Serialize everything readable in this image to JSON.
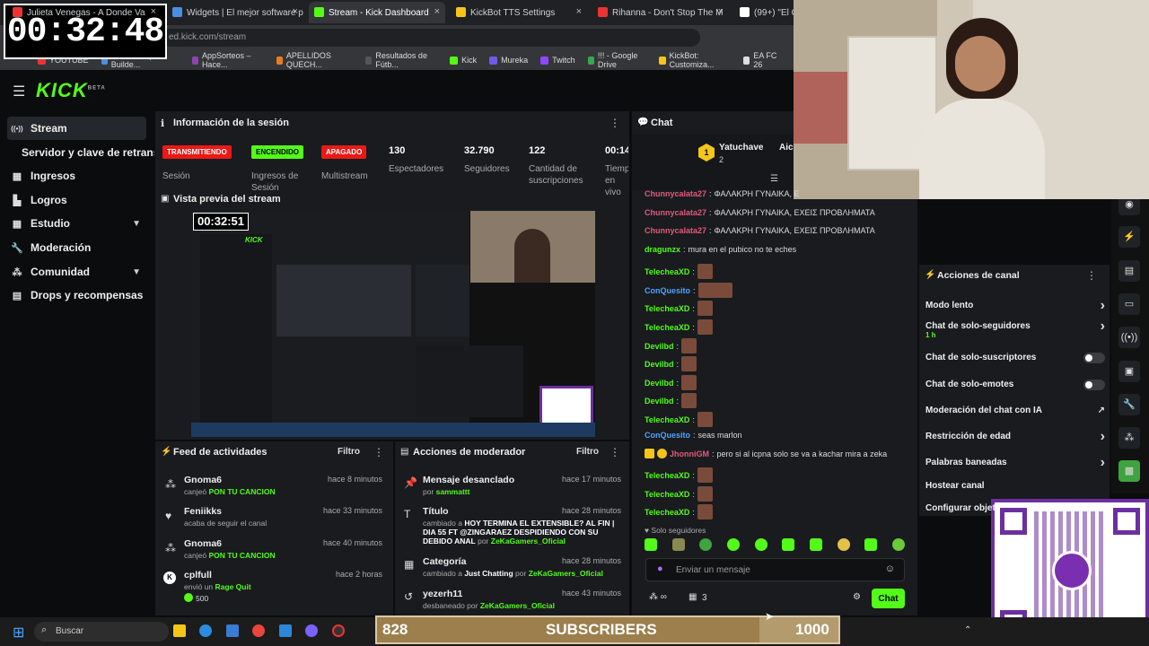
{
  "overlay": {
    "timer": "00:32:48",
    "sub_goal": {
      "current": "828",
      "label": "SUBSCRIBERS",
      "target": "1000",
      "progress": 0.828
    }
  },
  "browser": {
    "tabs": [
      {
        "label": "Julieta Venegas - A Donde Va",
        "color": "#e33"
      },
      {
        "label": "Widgets | El mejor software par",
        "color": "#4a90e2"
      },
      {
        "label": "Stream - Kick Dashboard",
        "color": "#53fc18"
      },
      {
        "label": "KickBot TTS Settings",
        "color": "#f5c518"
      },
      {
        "label": "Rihanna - Don't Stop The M",
        "color": "#e33"
      },
      {
        "label": "(99+) \"El Ori",
        "color": "#fff"
      }
    ],
    "url_prefix": "ed.kick.com/",
    "url_path": "stream",
    "bookmarks": [
      {
        "label": "YOUTUBE",
        "color": "#e33"
      },
      {
        "label": "FIFA 19 Squad Builde...",
        "color": "#4a90e2"
      },
      {
        "label": "AppSorteos – Hace...",
        "color": "#8e44ad"
      },
      {
        "label": "APELLIDOS QUECH...",
        "color": "#e67e22"
      },
      {
        "label": "Resultados de Fútb...",
        "color": "#555"
      },
      {
        "label": "Kick",
        "color": "#53fc18"
      },
      {
        "label": "Mureka",
        "color": "#6c5ce7"
      },
      {
        "label": "Twitch",
        "color": "#9146ff"
      },
      {
        "label": "!!! - Google Drive",
        "color": "#34a853"
      },
      {
        "label": "KickBot: Customiza...",
        "color": "#f5c518"
      },
      {
        "label": "EA FC 26",
        "color": "#ddd"
      }
    ]
  },
  "brand": {
    "logo": "KICK",
    "beta": "BETA",
    "accent": "#53fc18"
  },
  "sidebar": {
    "items": [
      {
        "label": "Stream",
        "icon": "broadcast-icon"
      },
      {
        "label": "Servidor y clave de retransm"
      },
      {
        "label": "Ingresos",
        "icon": "coins-icon"
      },
      {
        "label": "Logros",
        "icon": "trophy-icon"
      },
      {
        "label": "Estudio",
        "icon": "grid-icon"
      },
      {
        "label": "Moderación",
        "icon": "wrench-icon"
      },
      {
        "label": "Comunidad",
        "icon": "people-icon"
      },
      {
        "label": "Drops y recompensas",
        "icon": "gift-icon"
      }
    ]
  },
  "session": {
    "title": "Información de la sesión",
    "stats": [
      {
        "value": "TRANSMITIENDO",
        "label": "Sesión",
        "badge_color": "#e91916"
      },
      {
        "value": "ENCENDIDO",
        "label": "Ingresos de Sesión",
        "badge_color": "#53fc18"
      },
      {
        "value": "APAGADO",
        "label": "Multistream",
        "badge_color": "#e91916"
      },
      {
        "value": "130",
        "label": "Espectadores"
      },
      {
        "value": "32.790",
        "label": "Seguidores"
      },
      {
        "value": "122",
        "label": "Cantidad de suscripciones"
      },
      {
        "value": "00:14:",
        "label": "Tiempo en vivo"
      }
    ]
  },
  "preview": {
    "title": "Vista previa del stream",
    "timer": "00:32:51"
  },
  "activity": {
    "title": "Feed de actividades",
    "filter": "Filtro",
    "items": [
      {
        "name": "Gnoma6",
        "time": "hace 8 minutos",
        "action": "canjeó",
        "highlight": "PON TU CANCION",
        "icon": "reward-icon"
      },
      {
        "name": "Feniikks",
        "time": "hace 33 minutos",
        "action": "acaba de seguir el canal",
        "highlight": "",
        "icon": "heart-icon"
      },
      {
        "name": "Gnoma6",
        "time": "hace 40 minutos",
        "action": "canjeó",
        "highlight": "PON TU CANCION",
        "icon": "reward-icon"
      },
      {
        "name": "cplfull",
        "time": "hace 2 horas",
        "action": "envió un",
        "highlight": "Rage Quit",
        "extra": "500",
        "icon": "kick-coin-icon"
      }
    ]
  },
  "modactions": {
    "title": "Acciones de moderador",
    "filter": "Filtro",
    "items": [
      {
        "title": "Mensaje desanclado",
        "time": "hace 17 minutos",
        "pre": "por",
        "user": "sammattt"
      },
      {
        "title": "Título",
        "time": "hace 28 minutos",
        "pre": "cambiado a",
        "value": "HOY TERMINA EL EXTENSIBLE? AL FIN | DIA 55 FT @ZINGARAEZ DESPIDIENDO CON SU DEBIDO ANAL",
        "mid": "por",
        "user": "ZeKaGamers_Oficial"
      },
      {
        "title": "Categoría",
        "time": "hace 28 minutos",
        "pre": "cambiado a",
        "value": "Just Chatting",
        "mid": "por",
        "user": "ZeKaGamers_Oficial"
      },
      {
        "title": "yezerh11",
        "time": "hace 43 minutos",
        "pre": "desbaneado por",
        "user": "ZeKaGamers_Oficial"
      }
    ]
  },
  "chat": {
    "title": "Chat",
    "pinned_user": "Yatuchave",
    "pinned_count": "2",
    "pinned_extra": "Aic",
    "messages": [
      {
        "user": "Chunnycalata27",
        "color": "#e05a7a",
        "text": "ΦΑΛΑΚΡΗ ΓΥΝΑΙΚΑ, Ε"
      },
      {
        "user": "Chunnycalata27",
        "color": "#e05a7a",
        "text": "ΦΑΛΑΚΡΗ ΓΥΝΑΙΚΑ, ΕΧΕΙΣ ΠΡΟΒΛΗΜΑΤΑ"
      },
      {
        "user": "Chunnycalata27",
        "color": "#e05a7a",
        "text": "ΦΑΛΑΚΡΗ ΓΥΝΑΙΚΑ, ΕΧΕΙΣ ΠΡΟΒΛΗΜΑΤΑ"
      },
      {
        "user": "dragunzx",
        "color": "#53fc18",
        "text": "mura en el pubico no te eches"
      },
      {
        "user": "TelecheaXD",
        "color": "#53fc18",
        "text": "",
        "emote": 1
      },
      {
        "user": "ConQuesito",
        "color": "#4ea3ff",
        "text": "",
        "emote": 2
      },
      {
        "user": "TelecheaXD",
        "color": "#53fc18",
        "text": "",
        "emote": 1
      },
      {
        "user": "TelecheaXD",
        "color": "#53fc18",
        "text": "",
        "emote": 1
      },
      {
        "user": "Devilbd",
        "color": "#53fc18",
        "text": "",
        "emote": 1
      },
      {
        "user": "Devilbd",
        "color": "#53fc18",
        "text": "",
        "emote": 1
      },
      {
        "user": "Devilbd",
        "color": "#53fc18",
        "text": "",
        "emote": 1
      },
      {
        "user": "Devilbd",
        "color": "#53fc18",
        "text": "",
        "emote": 1
      },
      {
        "user": "TelecheaXD",
        "color": "#53fc18",
        "text": "",
        "emote": 1
      },
      {
        "user": "ConQuesito",
        "color": "#4ea3ff",
        "text": "seas marlon"
      },
      {
        "user": "JhonniGM",
        "color": "#e05a7a",
        "text": "pero si al icpna solo se va a kachar mira a zeka"
      },
      {
        "user": "TelecheaXD",
        "color": "#53fc18",
        "text": "",
        "emote": 1
      },
      {
        "user": "TelecheaXD",
        "color": "#53fc18",
        "text": "",
        "emote": 1
      },
      {
        "user": "TelecheaXD",
        "color": "#53fc18",
        "text": "",
        "emote": 1
      }
    ],
    "followers_only": "Solo seguidores",
    "input_placeholder": "Enviar un mensaje",
    "count": "3",
    "send_label": "Chat"
  },
  "channel_actions": {
    "title": "Acciones de canal",
    "items": [
      {
        "label": "Modo lento",
        "type": "arrow"
      },
      {
        "label": "Chat de solo-seguidores",
        "sub": "1 h",
        "type": "arrow"
      },
      {
        "label": "Chat de solo-suscriptores",
        "type": "toggle"
      },
      {
        "label": "Chat de solo-emotes",
        "type": "toggle"
      },
      {
        "label": "Moderación del chat con IA",
        "type": "link"
      },
      {
        "label": "Restricción de edad",
        "type": "arrow"
      },
      {
        "label": "Palabras baneadas",
        "type": "arrow"
      },
      {
        "label": "Hostear canal",
        "type": "none"
      },
      {
        "label": "Configurar objet",
        "type": "none"
      }
    ]
  },
  "taskbar": {
    "search": "Buscar"
  }
}
